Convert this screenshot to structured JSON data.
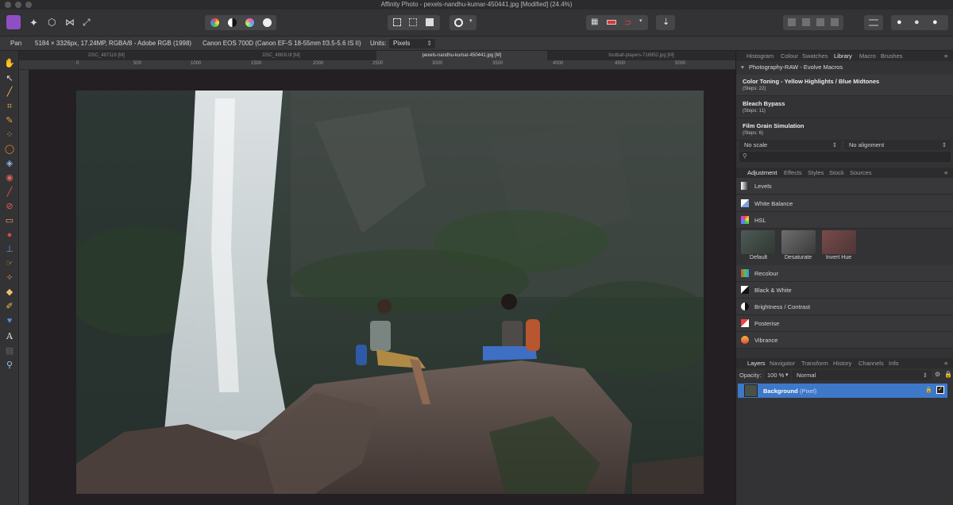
{
  "window": {
    "title": "Affinity Photo - pexels-nandhu-kumar-450441.jpg [Modified] (24.4%)"
  },
  "context_bar": {
    "tool": "Pan",
    "image_info": "5184 × 3326px, 17.24MP, RGBA/8 - Adobe RGB (1998)",
    "camera": "Canon EOS 700D (Canon EF-S 18-55mm f/3.5-5.6 IS II)",
    "units_label": "Units:",
    "units_value": "Pixels"
  },
  "doc_tabs": [
    {
      "label": "DSC_487119 [M]"
    },
    {
      "label": "DSC_4863t.tif [M]"
    },
    {
      "label": "pexels-nandhu-kumar-450441.jpg [M]"
    },
    {
      "label": "football-players-718952.jpg [M]"
    }
  ],
  "ruler": {
    "ticks": [
      "0",
      "500",
      "1000",
      "1500",
      "2000",
      "2500",
      "3000",
      "3500",
      "4000",
      "4500",
      "5000"
    ]
  },
  "library_panel": {
    "tabs": [
      "Histogram",
      "Colour",
      "Swatches",
      "Library",
      "Macro",
      "Brushes"
    ],
    "active_tab": "Library",
    "category": "Photography-RAW - Evolve Macros",
    "macros": [
      {
        "title": "Color Toning - Yellow Highlights / Blue Midtones",
        "steps": "(Steps: 22)"
      },
      {
        "title": "Bleach Bypass",
        "steps": "(Steps: 11)"
      },
      {
        "title": "Film Grain Simulation",
        "steps": "(Steps: 6)"
      }
    ],
    "scale_option": "No scale",
    "alignment_option": "No alignment"
  },
  "adjustment_panel": {
    "tabs": [
      "Adjustment",
      "Effects",
      "Styles",
      "Stock",
      "Sources"
    ],
    "active_tab": "Adjustment",
    "items_top": [
      {
        "label": "Levels",
        "icon": "levels-icon"
      },
      {
        "label": "White Balance",
        "icon": "white-balance-icon"
      },
      {
        "label": "HSL",
        "icon": "hsl-icon"
      }
    ],
    "presets": [
      {
        "label": "Default"
      },
      {
        "label": "Desaturate"
      },
      {
        "label": "Invert Hue"
      }
    ],
    "items_bottom": [
      {
        "label": "Recolour",
        "icon": "recolour-icon"
      },
      {
        "label": "Black & White",
        "icon": "black-white-icon"
      },
      {
        "label": "Brightness / Contrast",
        "icon": "brightness-contrast-icon"
      },
      {
        "label": "Posterise",
        "icon": "posterise-icon"
      },
      {
        "label": "Vibrance",
        "icon": "vibrance-icon"
      }
    ]
  },
  "layers_panel": {
    "tabs": [
      "Layers",
      "Navigator",
      "Transform",
      "History",
      "Channels",
      "Info"
    ],
    "active_tab": "Layers",
    "opacity_label": "Opacity:",
    "opacity_value": "100 %",
    "blend_mode": "Normal",
    "layer": {
      "name": "Background",
      "type": "(Pixel)"
    }
  }
}
